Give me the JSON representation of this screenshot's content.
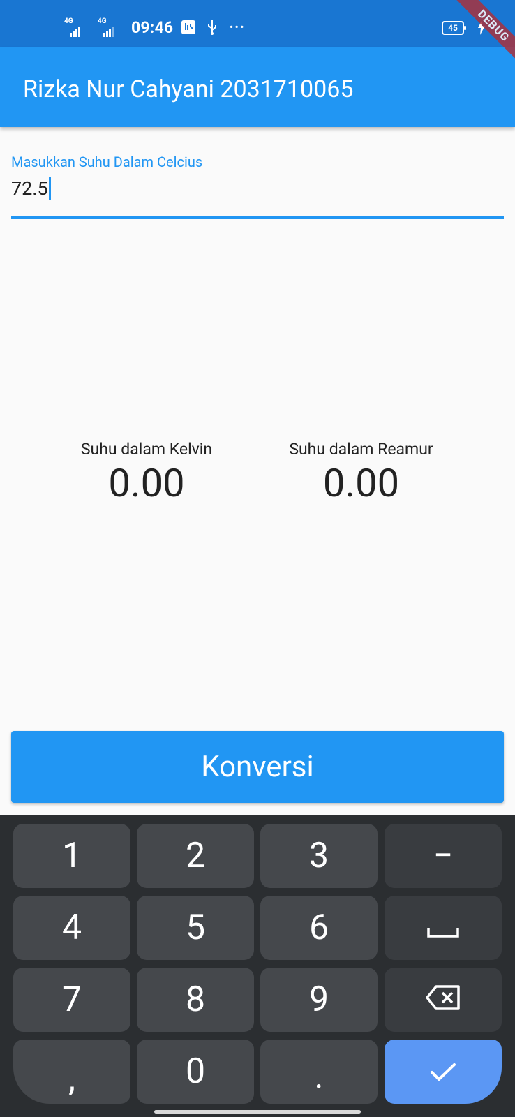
{
  "status_bar": {
    "network_1": "4G",
    "network_2": "4G",
    "time": "09:46",
    "battery": "45",
    "more": "···",
    "icons": [
      "signal-icon",
      "signal-icon",
      "notification-icon",
      "usb-icon",
      "more-icon",
      "battery-icon",
      "charging-icon"
    ]
  },
  "debug_banner": "DEBUG",
  "app_bar": {
    "title": "Rizka Nur Cahyani 2031710065"
  },
  "input": {
    "label": "Masukkan Suhu Dalam Celcius",
    "value": "72.5"
  },
  "results": {
    "kelvin": {
      "label": "Suhu dalam Kelvin",
      "value": "0.00"
    },
    "reamur": {
      "label": "Suhu dalam Reamur",
      "value": "0.00"
    }
  },
  "convert_button": {
    "label": "Konversi"
  },
  "keyboard": {
    "rows": [
      [
        "1",
        "2",
        "3",
        "−"
      ],
      [
        "4",
        "5",
        "6",
        "space"
      ],
      [
        "7",
        "8",
        "9",
        "backspace"
      ],
      [
        ",",
        "0",
        ".",
        "done"
      ]
    ]
  },
  "colors": {
    "primary": "#2196f3",
    "status_bar": "#1976d2",
    "keyboard_bg": "#2b2e31",
    "key": "#45484c",
    "enter_key": "#5b97f4"
  }
}
